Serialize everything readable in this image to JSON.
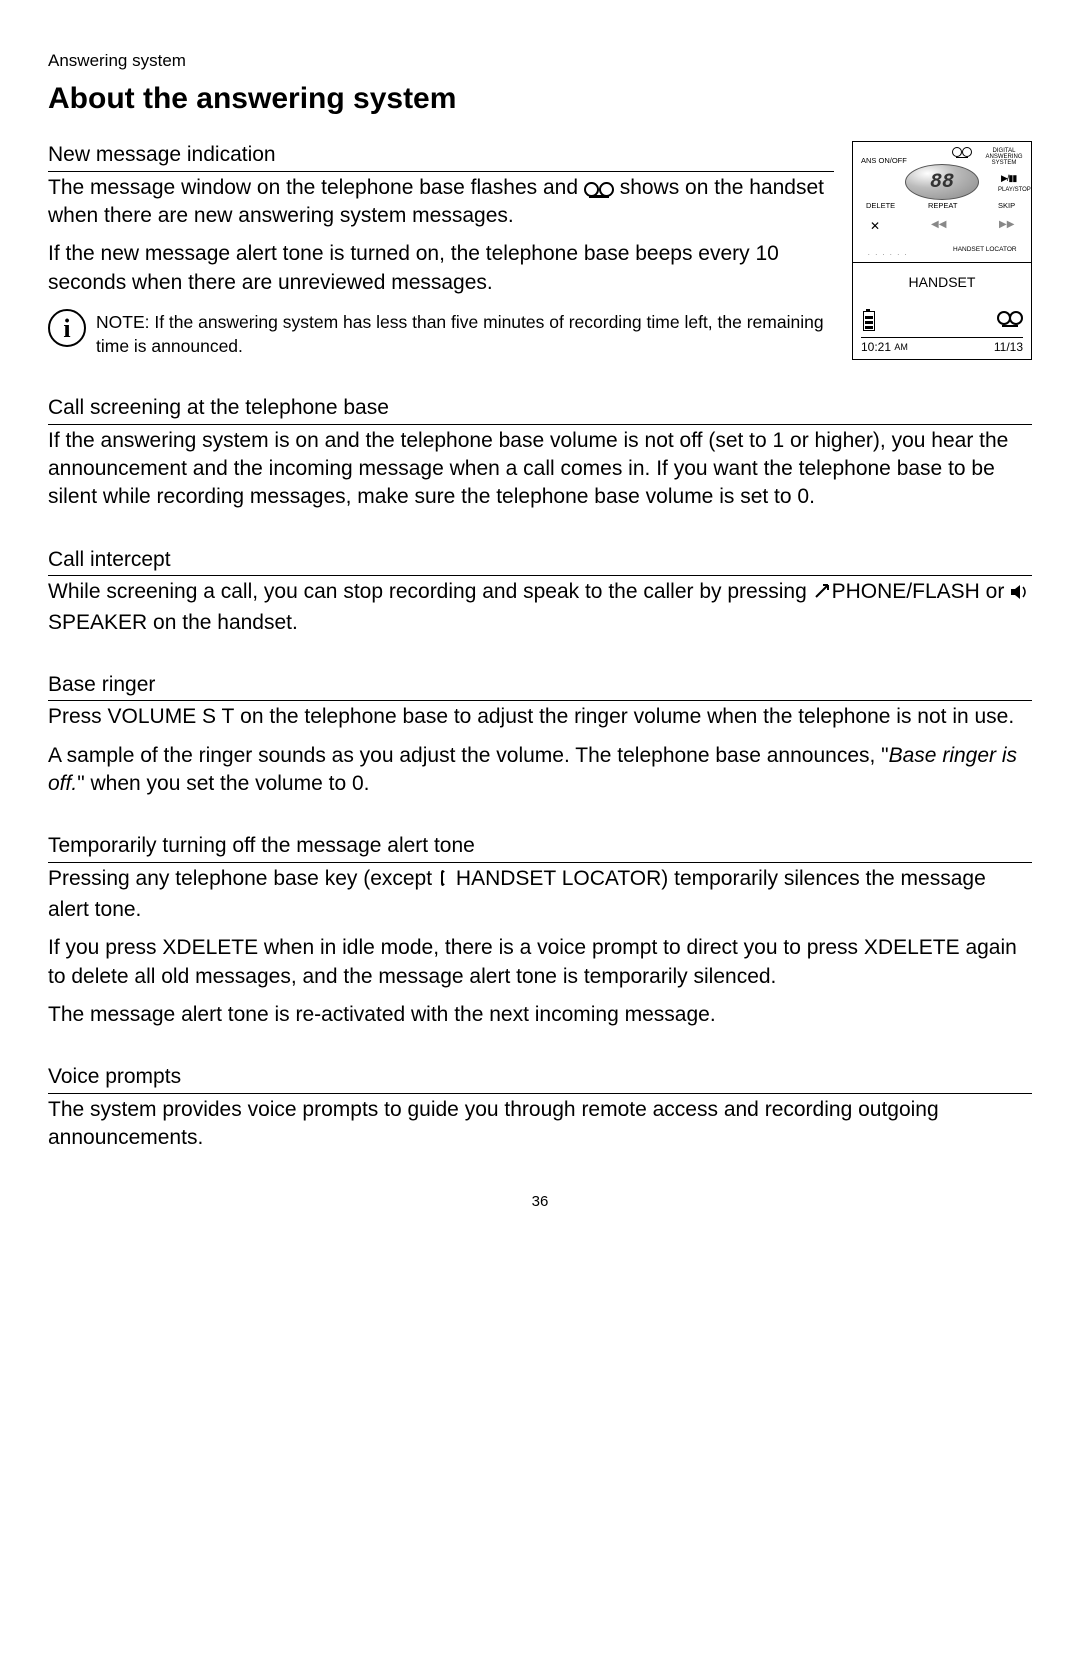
{
  "header": {
    "section_label": "Answering system",
    "title": "About the answering system"
  },
  "device": {
    "top": {
      "ans_onoff": "ANS ON/OFF",
      "digital": "DIGITAL ANSWERING SYSTEM",
      "playstop": "PLAY/STOP",
      "delete": "DELETE",
      "repeat": "REPEAT",
      "skip": "SKIP",
      "handset_locator": "HANDSET LOCATOR",
      "counter": "88",
      "play_pause": "▶/▮▮",
      "x": "✕",
      "rw": "◀◀",
      "fw": "▶▶",
      "dots": ". . . . . ."
    },
    "bottom": {
      "handset": "HANDSET",
      "time": "10:21",
      "ampm": "AM",
      "date": "11/13"
    }
  },
  "s1": {
    "heading": "New message indication",
    "p1a": "The message window on the telephone base flashes and ",
    "p1b": " shows on the handset when there are new answering system messages.",
    "p2": "If the new message alert tone is turned on, the telephone base beeps every 10 seconds when there are unreviewed messages.",
    "note_label": "NOTE:",
    "note_body": " If the answering system has less than five minutes of recording time left, the remaining time is announced."
  },
  "s2": {
    "heading": "Call screening at the telephone base",
    "p1": "If the answering system is on and the telephone base volume is not off (set to 1 or higher), you hear the announcement and the incoming message when a call comes in. If you want the telephone base to be silent while recording messages, make sure the telephone base volume is set to 0."
  },
  "s3": {
    "heading": "Call intercept",
    "p1a": "While screening a call, you can stop recording and speak to the caller by pressing ",
    "phone": "PHONE",
    "flash": "/FLASH",
    "or": " or ",
    "speaker": "SPEAKER",
    "p1b": " on the handset."
  },
  "s4": {
    "heading": "Base ringer",
    "p1a": "Press ",
    "vol": "VOLUME S T",
    "p1b": " on the telephone base to adjust the ringer volume when the telephone is not in use.",
    "p2a": "A sample of the ringer sounds as you adjust the volume. The telephone base announces, \"",
    "msg": "Base ringer is off.",
    "p2b": "\" when you set the volume to 0."
  },
  "s5": {
    "heading": "Temporarily turning off the message alert tone",
    "p1a": "Pressing any telephone base key (except ",
    "hl": "HANDSET LOCATOR",
    "p1b": ") temporarily silences the message alert tone.",
    "p2a": "If you press ",
    "xdel1": "XDELETE",
    "p2b": " when in idle mode, there is a voice prompt to direct you to press ",
    "xdel2": "XDELETE",
    "p2c": " again to delete all old messages, and the message alert tone is temporarily silenced.",
    "p3": "The message alert tone is re-activated with the next incoming message."
  },
  "s6": {
    "heading": "Voice prompts",
    "p1": "The system provides voice prompts to guide you through remote access and recording outgoing announcements."
  },
  "page_number": "36"
}
